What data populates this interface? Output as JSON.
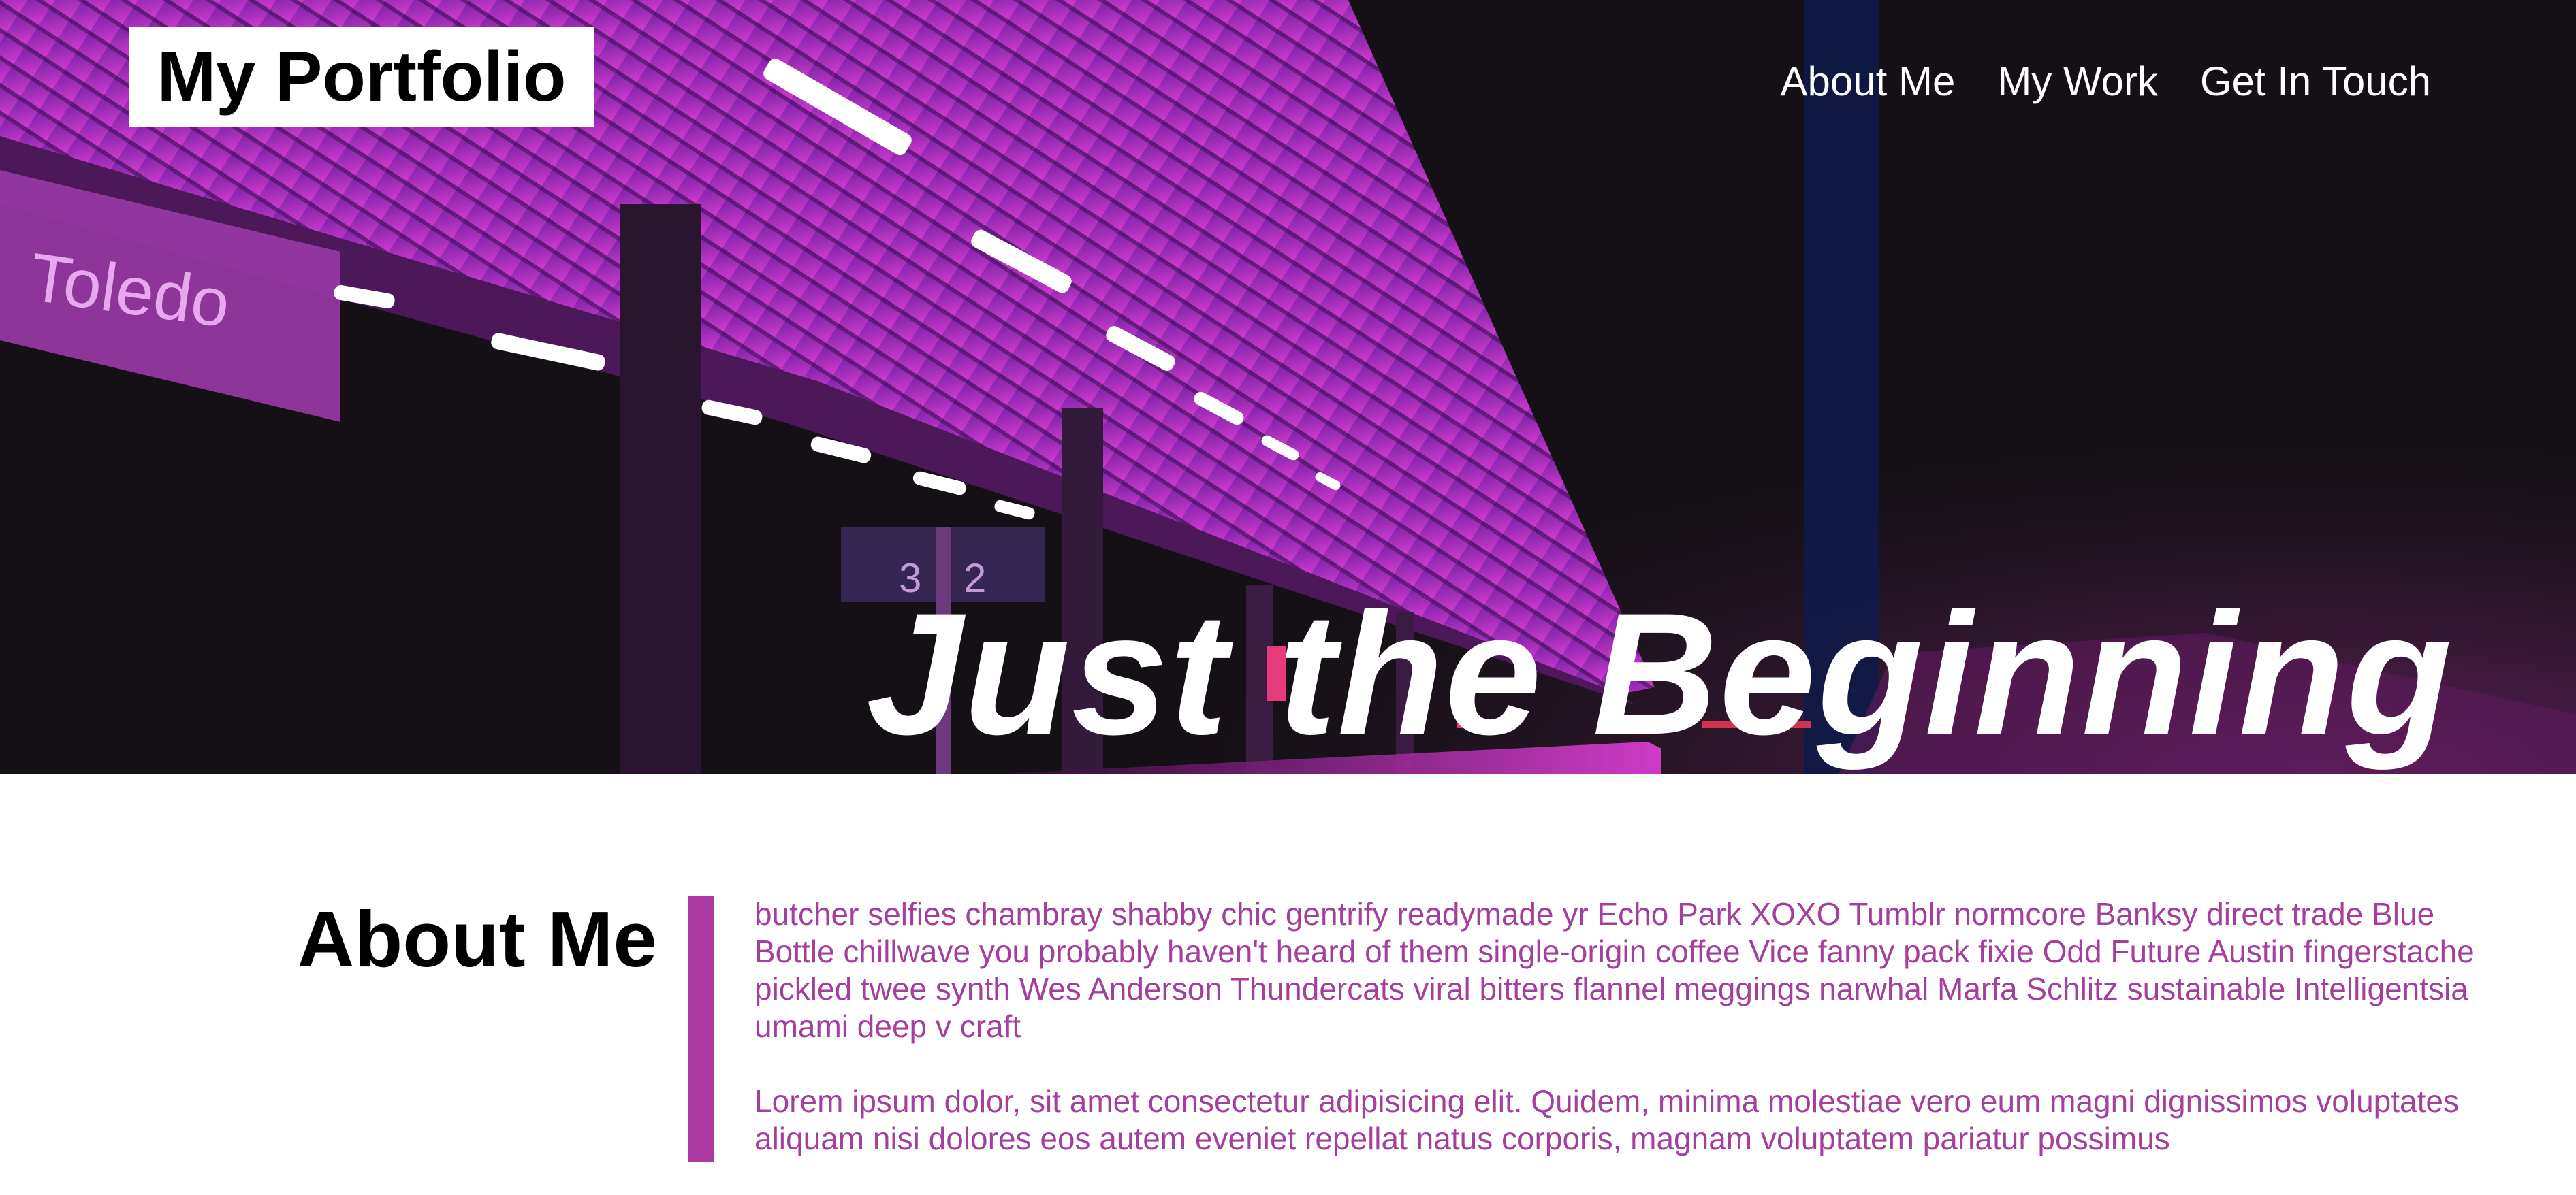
{
  "header": {
    "logo_text": "My Portfolio",
    "nav": [
      {
        "label": "About Me"
      },
      {
        "label": "My Work"
      },
      {
        "label": "Get In Touch"
      }
    ]
  },
  "hero": {
    "title": "Just the Beginning",
    "photo": {
      "sign_text": "Toledo",
      "platform_numbers": [
        "3",
        "2"
      ]
    }
  },
  "about": {
    "heading": "About Me",
    "paragraphs": [
      "butcher selfies chambray shabby chic gentrify readymade yr Echo Park XOXO Tumblr normcore Banksy direct trade Blue Bottle chillwave you probably haven't heard of them single-origin coffee Vice fanny pack fixie Odd Future Austin fingerstache pickled twee synth Wes Anderson Thundercats viral bitters flannel meggings narwhal Marfa Schlitz sustainable Intelligentsia umami deep v craft",
      "Lorem ipsum dolor, sit amet consectetur adipisicing elit. Quidem, minima molestiae vero eum magni dignissimos voluptates aliquam nisi dolores eos autem eveniet repellat natus corporis, magnam voluptatem pariatur possimus"
    ]
  },
  "colors": {
    "accent": "#ad3aa1",
    "body_text": "#a53f9d",
    "hero_dark": "#151116",
    "neon": "#c534c8"
  }
}
